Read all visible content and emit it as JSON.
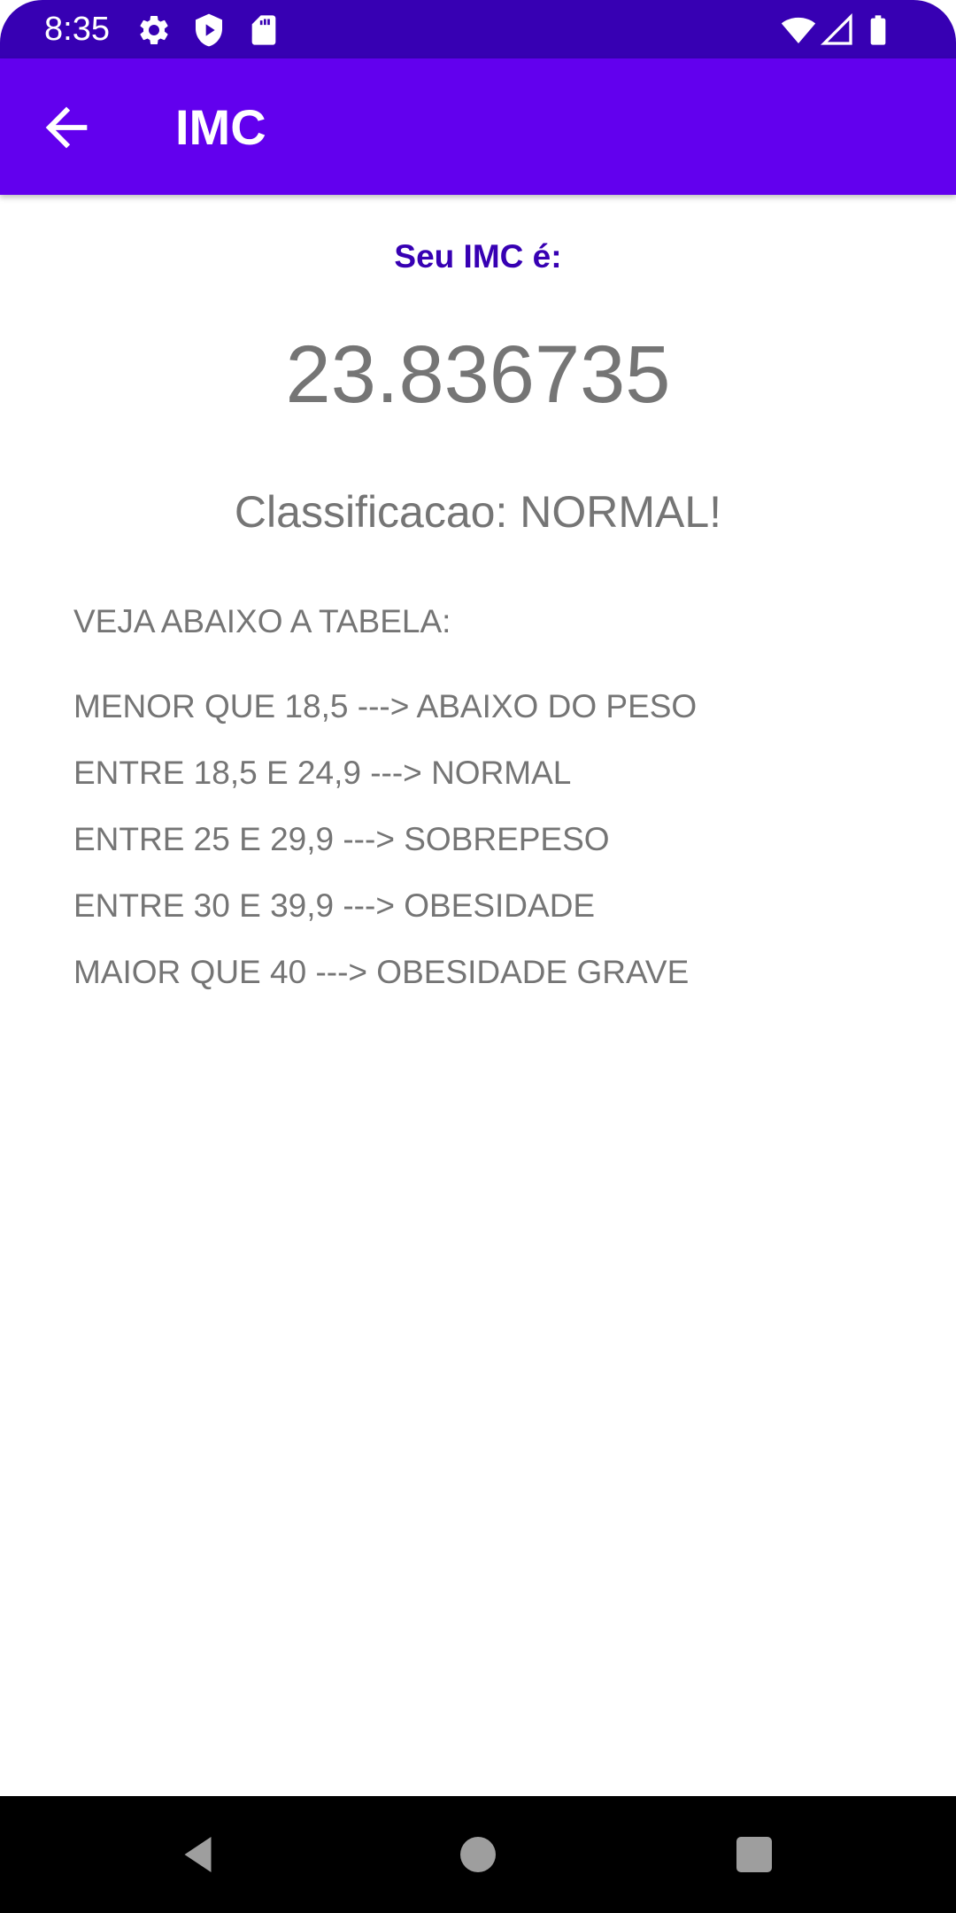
{
  "status_bar": {
    "time": "8:35",
    "left_icons": [
      "gear-icon",
      "shield-play-icon",
      "sd-card-icon"
    ],
    "right_icons": [
      "wifi-icon",
      "signal-icon",
      "battery-icon"
    ],
    "background_color": "#3700b3"
  },
  "app_bar": {
    "title": "IMC",
    "back_icon": "arrow-back-icon",
    "background_color": "#6200ee"
  },
  "result": {
    "label": "Seu IMC é:",
    "value": "23.836735",
    "classification": "Classificacao: NORMAL!",
    "label_color": "#3700b3",
    "text_color": "#757575"
  },
  "table": {
    "heading": "VEJA ABAIXO A TABELA:",
    "rows": [
      "MENOR QUE 18,5 ---> ABAIXO DO PESO",
      "ENTRE 18,5 E 24,9 ---> NORMAL",
      "ENTRE 25 E 29,9 ---> SOBREPESO",
      "ENTRE 30 E 39,9 ---> OBESIDADE",
      "MAIOR QUE 40 ---> OBESIDADE GRAVE"
    ]
  },
  "nav_bar": {
    "buttons": [
      "back-triangle-icon",
      "home-circle-icon",
      "recents-square-icon"
    ]
  }
}
